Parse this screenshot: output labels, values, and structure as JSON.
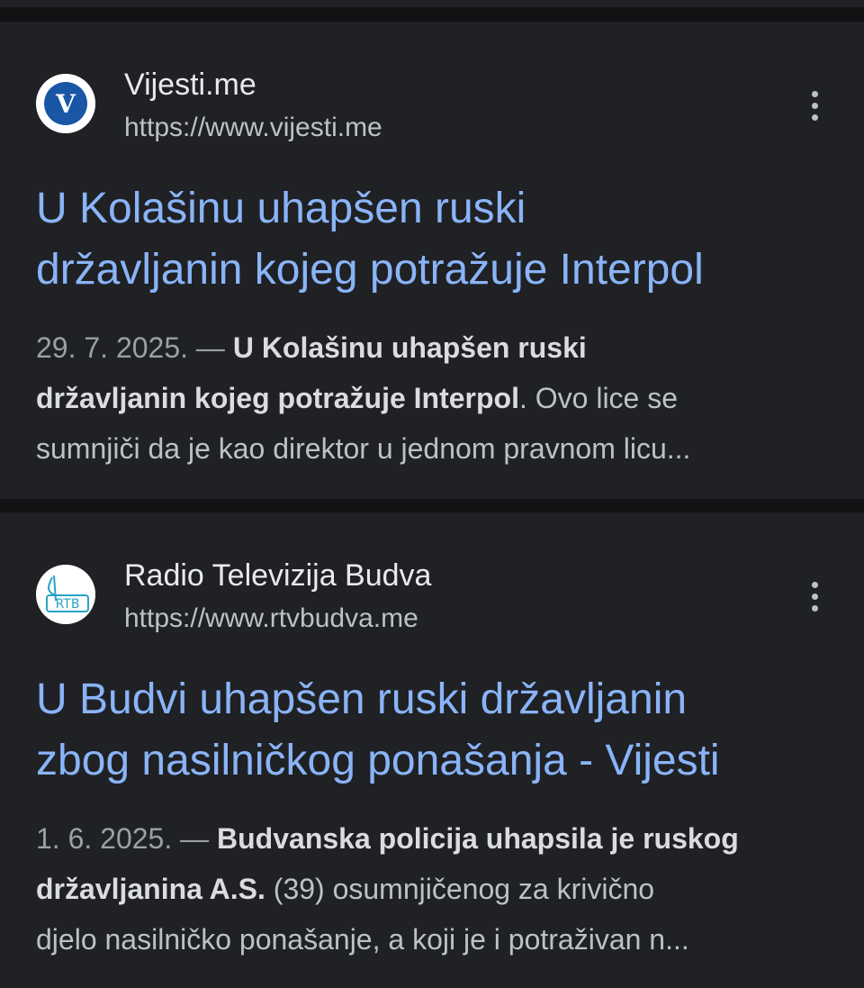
{
  "results": [
    {
      "site_name": "Vijesti.me",
      "url": "https://www.vijesti.me",
      "favicon_letter": "V",
      "favicon_color": "#1a56a6",
      "title_line1": "U Kolašinu uhapšen ruski",
      "title_line2": "državljanin kojeg potražuje Interpol",
      "snippet": {
        "date": "29. 7. 2025.",
        "separator": " — ",
        "bold_part1": "U Kolašinu uhapšen ruski",
        "bold_part2": "državljanin kojeg potražuje Interpol",
        "rest_line2": ". Ovo lice se",
        "line3": "sumnjiči da je kao direktor u jednom pravnom licu..."
      }
    },
    {
      "site_name": "Radio Televizija Budva",
      "url": "https://www.rtvbudva.me",
      "favicon_text": "RTB",
      "favicon_color": "#29a3c7",
      "title_line1": "U Budvi uhapšen ruski državljanin",
      "title_line2": "zbog nasilničkog ponašanja - Vijesti",
      "snippet": {
        "date": "1. 6. 2025.",
        "separator": " — ",
        "bold_part1": "Budvanska policija uhapsila je ruskog",
        "bold_part2": "državljanina A.S.",
        "rest_line2": " (39) osumnjičenog za krivično",
        "line3": "djelo nasilničko ponašanje, a koji je i potraživan n..."
      }
    }
  ],
  "icons": {
    "menu": "more-vert-icon"
  },
  "colors": {
    "background": "#111214",
    "card": "#202124",
    "link": "#8ab4f8",
    "text": "#bdc1c6"
  }
}
